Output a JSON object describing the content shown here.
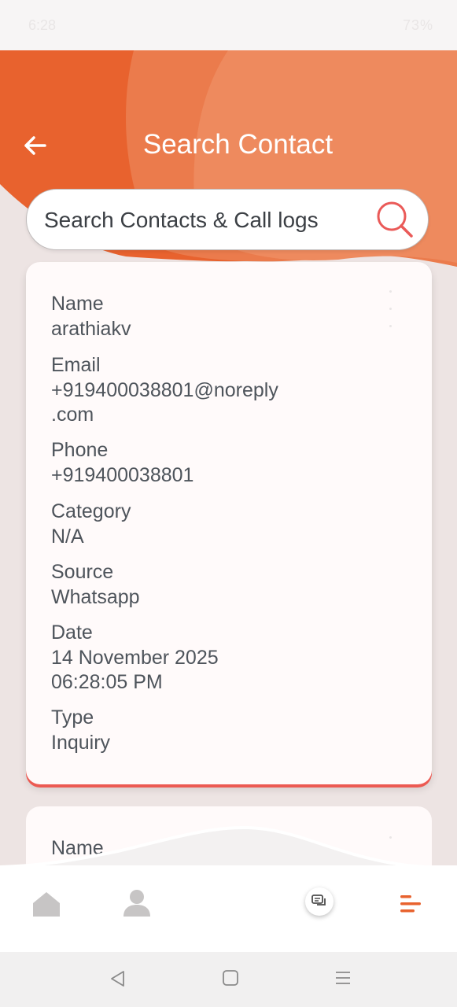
{
  "status_bar": {
    "time": "6:28",
    "indicators": "73%"
  },
  "header": {
    "title": "Search Contact",
    "back_icon": "arrow-left-icon"
  },
  "search": {
    "placeholder": "Search Contacts & Call logs",
    "value": "",
    "icon": "search-icon"
  },
  "colors": {
    "accent": "#e8622e",
    "accent_light": "#ee8a5e",
    "card_border": "#ec5a52",
    "background": "#ede4e3"
  },
  "contacts": [
    {
      "name_label": "Name",
      "name": "arathiakv",
      "email_label": "Email",
      "email": "+919400038801@noreply\n.com",
      "phone_label": "Phone",
      "phone": "+919400038801",
      "category_label": "Category",
      "category": "N/A",
      "source_label": "Source",
      "source": "Whatsapp",
      "date_label": "Date",
      "date": "14 November 2025\n06:28:05 PM",
      "type_label": "Type",
      "type": "Inquiry"
    },
    {
      "name_label": "Name"
    }
  ],
  "bottom_nav": {
    "items": [
      {
        "icon": "home-icon"
      },
      {
        "icon": "profile-icon"
      },
      {
        "icon": "chat-icon"
      },
      {
        "icon": "menu-icon",
        "active": true
      }
    ]
  },
  "system_nav": {
    "back": "back-triangle-icon",
    "home": "home-square-icon",
    "recents": "recents-icon"
  }
}
